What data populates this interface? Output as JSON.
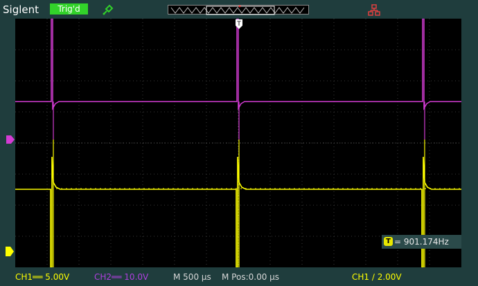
{
  "header": {
    "brand": "Siglent",
    "trigger_status": "Trig'd",
    "probe_icon": "probe-icon",
    "network_icon": "network-icon"
  },
  "colors": {
    "ch1": "#ffff00",
    "ch2": "#d43cd4",
    "screen_bg": "#000000",
    "frame_bg": "#1f3d3d",
    "trigger_badge": "#32d22a"
  },
  "screen": {
    "trigger_marker": "T",
    "ch2_marker": "2",
    "ch1_marker": "1"
  },
  "measure": {
    "trigger_icon": "T",
    "frequency": "= 901.174Hz"
  },
  "footer": {
    "ch1_scale": "CH1══ 5.00V",
    "ch2_scale": "CH2══ 10.0V",
    "timebase": "M 500 µs",
    "mpos": "M Pos:0.00 µs",
    "trigger_setting": "CH1 ∕ 2.00V"
  }
}
